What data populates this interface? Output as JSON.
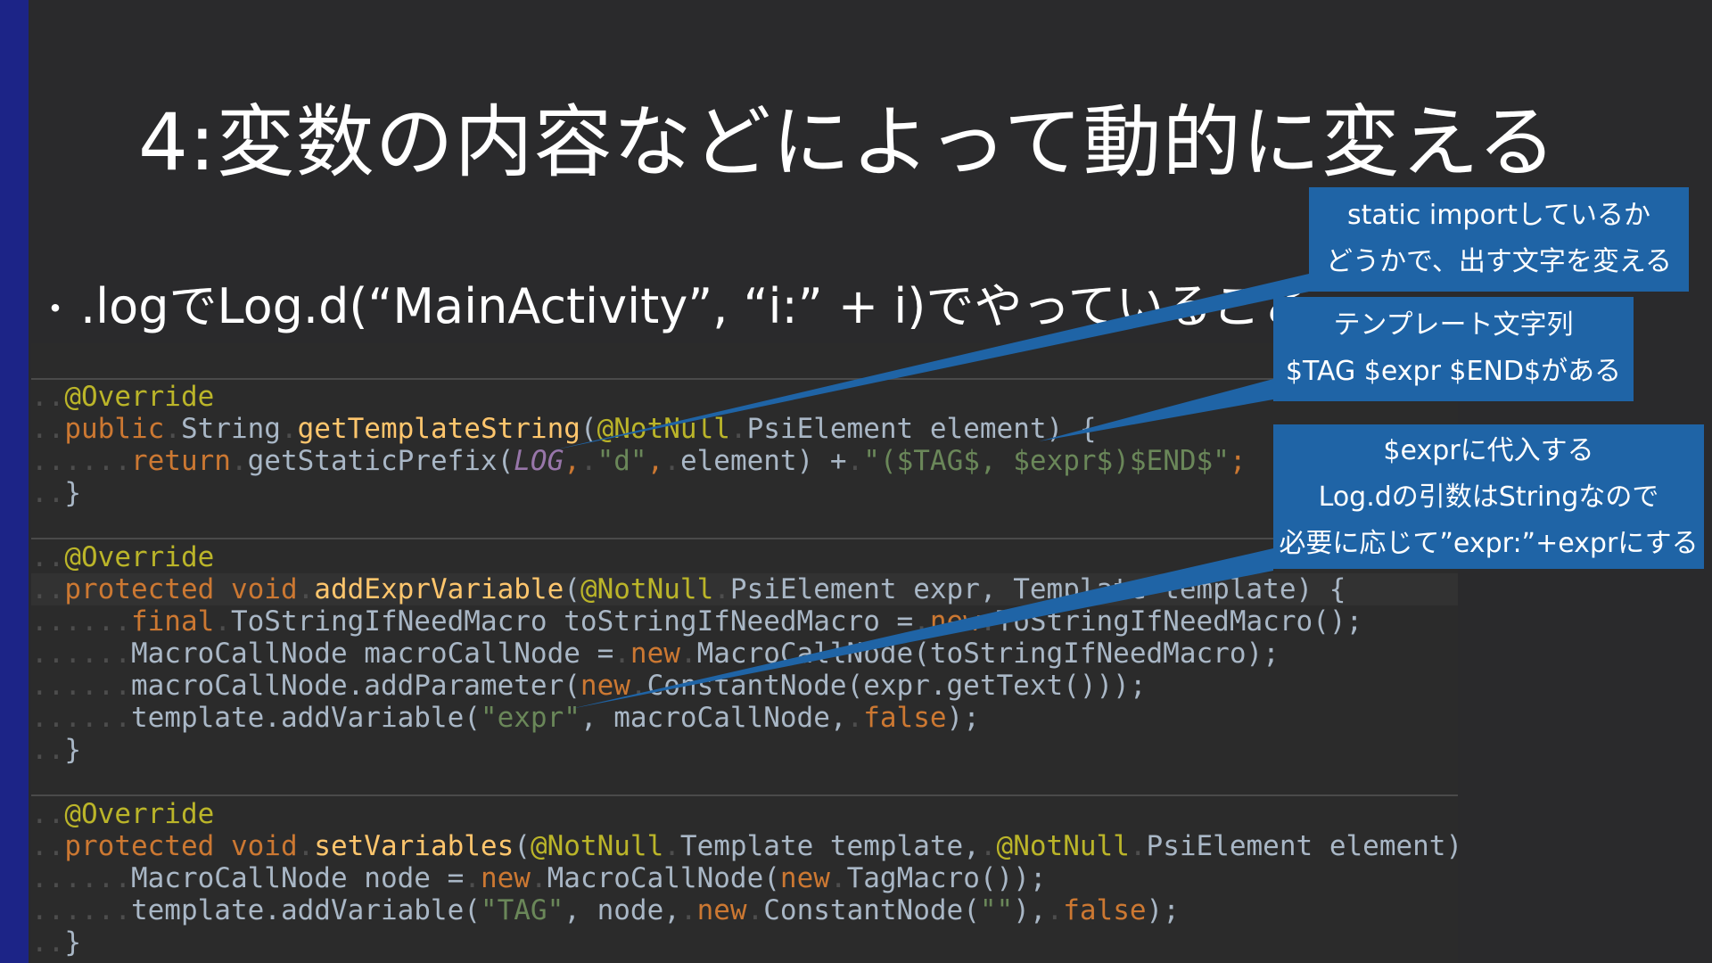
{
  "slide": {
    "title": "4:変数の内容などによって動的に変える",
    "bullet": ".logでLog.d(“MainActivity”, “i:” + i)でやっていること",
    "bullet_marker": "・"
  },
  "code": {
    "block1": {
      "annotation": "@Override",
      "sig_kw": "public",
      "sig_type": "String",
      "sig_fn": "getTemplateString",
      "sig_ann": "@NotNull",
      "sig_rest": "PsiElement element) {",
      "ret_kw": "return",
      "ret_call": "getStaticPrefix(",
      "ret_const": "LOG",
      "ret_str1": "\"d\"",
      "ret_mid": "element) +",
      "ret_str2": "\"($TAG$, $expr$)$END$\"",
      "close": "}"
    },
    "block2": {
      "annotation": "@Override",
      "sig_kw": "protected void",
      "sig_fn": "addExprVariable",
      "sig_ann": "@NotNull",
      "sig_rest": "PsiElement expr, Template template) {",
      "l1_kw": "final",
      "l1_text": "ToStringIfNeedMacro toStringIfNeedMacro =",
      "l1_new": "new",
      "l1_rest": "ToStringIfNeedMacro();",
      "l2_text": "MacroCallNode macroCallNode =",
      "l2_new": "new",
      "l2_rest": "MacroCallNode(toStringIfNeedMacro);",
      "l3_text": "macroCallNode.addParameter(",
      "l3_new": "new",
      "l3_rest": "ConstantNode(expr.getText()));",
      "l4_text": "template.addVariable(",
      "l4_str": "\"expr\"",
      "l4_mid": ", macroCallNode,",
      "l4_kw": "false",
      "l4_end": ");",
      "close": "}"
    },
    "block3": {
      "annotation": "@Override",
      "sig_kw": "protected void",
      "sig_fn": "setVariables",
      "sig_ann1": "@NotNull",
      "sig_mid": "Template template,",
      "sig_ann2": "@NotNull",
      "sig_rest": "PsiElement element) {",
      "l1_text": "MacroCallNode node =",
      "l1_new": "new",
      "l1_mid": "MacroCallNode(",
      "l1_new2": "new",
      "l1_rest": "TagMacro());",
      "l2_text": "template.addVariable(",
      "l2_str": "\"TAG\"",
      "l2_mid": ", node,",
      "l2_new": "new",
      "l2_mid2": "ConstantNode(",
      "l2_str2": "\"\"",
      "l2_mid3": "),",
      "l2_kw": "false",
      "l2_end": ");",
      "close": "}"
    }
  },
  "callouts": [
    {
      "lines": [
        "static importしているか",
        "どうかで、出す文字を変える"
      ]
    },
    {
      "lines": [
        "テンプレート文字列",
        "$TAG $expr $END$がある"
      ]
    },
    {
      "lines": [
        "$exprに代入する",
        "Log.dの引数はStringなので",
        "必要に応じて”expr:”+exprにする"
      ]
    }
  ],
  "colors": {
    "background": "#2a2a2c",
    "left_bar": "#1c2487",
    "callout": "#1f64a6",
    "annotation": "#bbb529",
    "keyword": "#cc7832",
    "function": "#ffc66d",
    "string": "#6a8759",
    "constant": "#9876aa"
  }
}
